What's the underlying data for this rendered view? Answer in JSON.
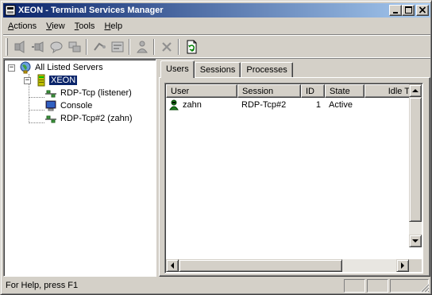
{
  "window": {
    "title": "XEON - Terminal Services Manager",
    "controls": {
      "minimize": "_",
      "maximize": "□",
      "close": "×"
    }
  },
  "menu": [
    {
      "label": "Actions"
    },
    {
      "label": "View"
    },
    {
      "label": "Tools"
    },
    {
      "label": "Help"
    }
  ],
  "toolbar": {
    "icons": [
      "send-message-icon",
      "connect-icon",
      "message-icon",
      "remote-control-icon",
      "reset-icon",
      "status-icon",
      "logoff-icon",
      "disconnect-icon",
      "refresh-icon"
    ]
  },
  "tree": {
    "root": {
      "label": "All Listed Servers",
      "expanded": true
    },
    "server": {
      "label": "XEON",
      "expanded": true,
      "selected": true
    },
    "sessions": [
      {
        "label": "RDP-Tcp (listener)",
        "icon": "network-icon"
      },
      {
        "label": "Console",
        "icon": "monitor-icon"
      },
      {
        "label": "RDP-Tcp#2 (zahn)",
        "icon": "network-icon"
      }
    ]
  },
  "tabs": [
    {
      "label": "Users",
      "active": true
    },
    {
      "label": "Sessions",
      "active": false
    },
    {
      "label": "Processes",
      "active": false
    }
  ],
  "users_table": {
    "columns": [
      "User",
      "Session",
      "ID",
      "State",
      "Idle T"
    ],
    "rows": [
      {
        "user": "zahn",
        "session": "RDP-Tcp#2",
        "id": "1",
        "state": "Active",
        "idle": ""
      }
    ]
  },
  "status": {
    "text": "For Help, press F1"
  },
  "colors": {
    "title_start": "#0a246a",
    "title_end": "#a6caf0",
    "face": "#d4d0c8",
    "selection": "#0a246a"
  }
}
